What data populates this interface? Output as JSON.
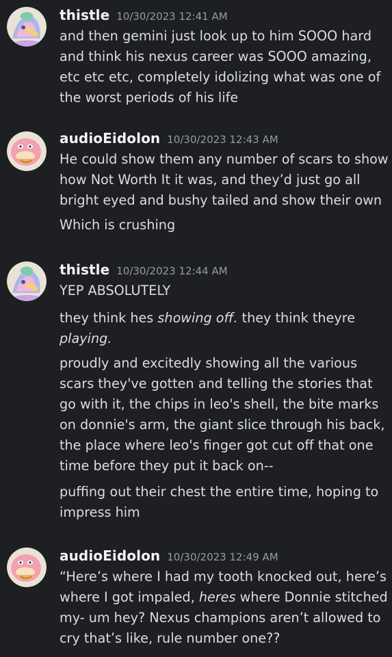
{
  "messages": [
    {
      "username": "thistle",
      "timestamp": "10/30/2023 12:41 AM",
      "avatar": "pastel-character-avatar",
      "lines": [
        "and then gemini just look up to him SOOO hard",
        "and think his nexus career was SOOO amazing,",
        "etc etc etc, completely idolizing what was one of",
        "the worst periods of his life"
      ]
    },
    {
      "username": "audioEidolon",
      "timestamp": "10/30/2023 12:43 AM",
      "avatar": "slowpoke-avatar",
      "lines": [
        "He could show them any number of scars to show",
        "how Not Worth It it was, and they’d just go all",
        "bright eyed and bushy tailed and show their own",
        "Which is crushing"
      ]
    },
    {
      "username": "thistle",
      "timestamp": "10/30/2023 12:44 AM",
      "avatar": "pastel-character-avatar",
      "lines": [
        "YEP ABSOLUTELY",
        "they think hes ",
        "showing off.",
        " they think theyre",
        "playing.",
        "proudly and excitedly showing all the various",
        "scars they've gotten and telling the stories that",
        "go with it, the chips in leo's shell, the bite marks",
        "on donnie's arm, the giant slice through his back,",
        "the place where leo's finger got cut off that one",
        "time before they put it back on--",
        "puffing out their chest the entire time, hoping to",
        "impress him"
      ]
    },
    {
      "username": "audioEidolon",
      "timestamp": "10/30/2023 12:49 AM",
      "avatar": "slowpoke-avatar",
      "lines": [
        "“Here’s where I had my tooth knocked out, here’s",
        "where I got impaled, ",
        "heres",
        " where Donnie stitched",
        "my- um hey? Nexus champions aren’t allowed to",
        "cry that’s like, rule number one??"
      ]
    }
  ],
  "colors": {
    "background": "#1e1f22",
    "username": "#f2f3f5",
    "timestamp": "#949ba4",
    "text": "#dbdee1"
  }
}
